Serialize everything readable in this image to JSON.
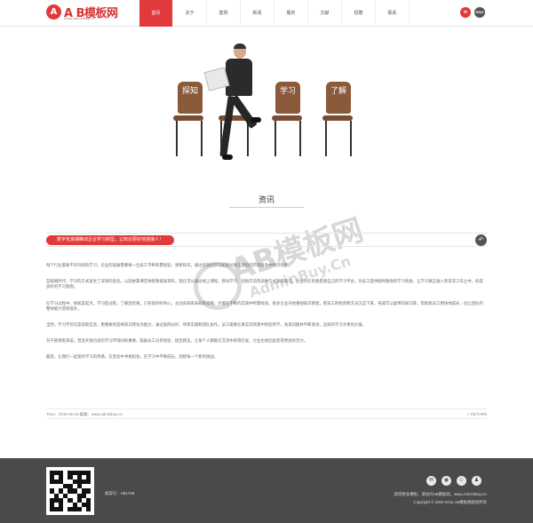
{
  "header": {
    "logo_mark": "A",
    "logo_text": "A B模板网",
    "logo_sub": "Www.AdminBuy.Cn",
    "nav": [
      "首页",
      "关于",
      "案例",
      "新闻",
      "服务",
      "文献",
      "招聘",
      "联系"
    ],
    "lang_cn": "中",
    "lang_en": "ENG"
  },
  "hero": {
    "chairs": [
      "探知",
      "学习",
      "了解"
    ]
  },
  "section": {
    "title": "资讯"
  },
  "watermark": {
    "text": "AB模板网",
    "url": "AdminBuy.Cn"
  },
  "article": {
    "title": "数字化浪潮推动企业学习转型，让知识更好地连接人！",
    "back_icon": "back-icon",
    "paragraphs": [
      "每个行业都离不开持续的学习，企业的发展需要每一位员工不断积累经验、更新知识，通过有效的学习机制才能在激烈的市场竞争中保持优势。",
      "互联网时代，学习的方式发生了深刻的变化。以前依靠课堂讲授和纸质资料，现在可以通过线上课程、移动学习、社群交流等多种方式获取知识。企业也在积极搭建自己的学习平台，为员工提供随时随地的学习机会，让学习真正融入到日常工作之中，形成良好的学习氛围。",
      "在学习过程中，探知是起点，学习是过程，了解是结果。只有保持好奇心，主动去探索未知的领域，才能在不断的实践中积累经验。很多企业开始重视知识管理，把员工的经验和方法沉淀下来，形成可以复用的知识库，帮助新员工更快地成长，也让团队的整体能力得到提升。",
      "当然，学习不仅仅是获取信息，更重要的是将知识转化为能力。通过案例分析、项目实践和团队协作，员工能够在真实的场景中检验所学，发现问题并不断改进，这样的学习才更有价值。",
      "对于管理者来说，营造开放包容的学习环境同样重要。鼓励员工分享经验、提出建议，让每个人都能在交流中获得启发，企业也会因此变得更加有活力。",
      "最后，让我们一起保持学习的热情，在变化中寻找机会，在学习中不断成长，迎接每一个新的挑战。"
    ],
    "meta": "Time：2015-05-18   编辑：www.adminbuy.cn",
    "return": "< RETURN"
  },
  "footer": {
    "code": "备案号：AB1768",
    "icons": [
      "wechat-icon",
      "weibo-icon",
      "qq-icon",
      "user-icon"
    ],
    "icon_glyphs": [
      "✉",
      "◉",
      "☺",
      "♟"
    ],
    "line1": "获得更多模板，请访问AB模板网，www.AdminBuy.Cn",
    "line2": "Copyright © 2002-2011 AB模板网版权所有"
  }
}
